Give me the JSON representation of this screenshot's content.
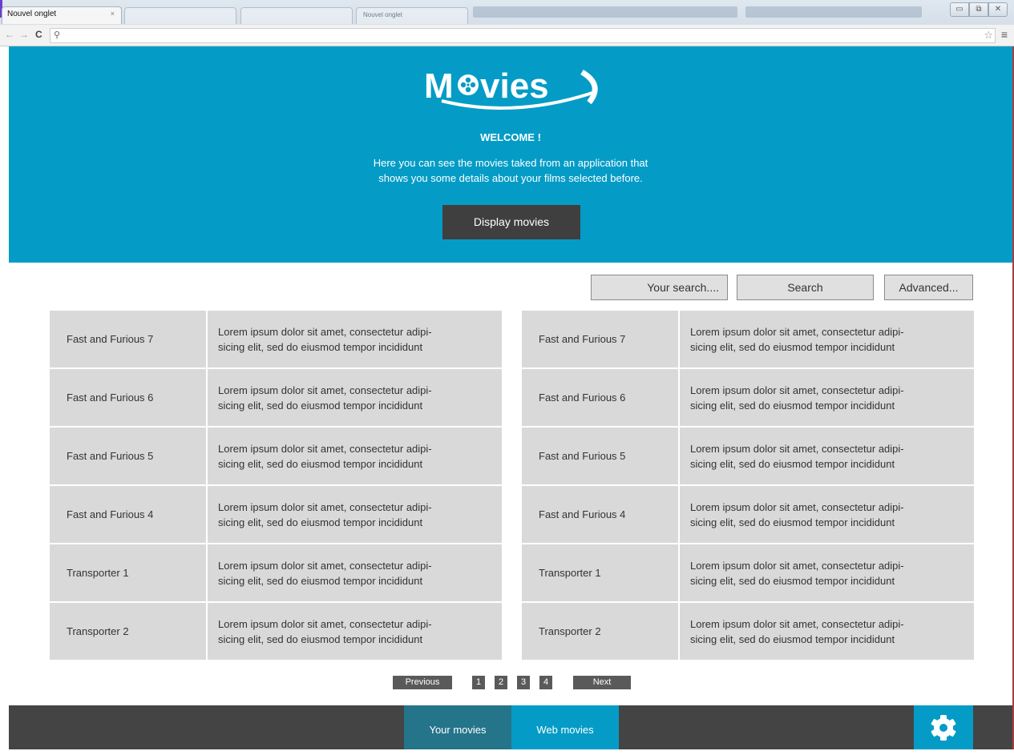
{
  "browser": {
    "active_tab_label": "Nouvel onglet",
    "tab_close": "×",
    "ghost_tab_3": "Nouvel onglet",
    "win_minimize": "▭",
    "win_restore": "⧉",
    "win_close": "✕",
    "back": "←",
    "forward": "→",
    "reload": "C",
    "search_glyph": "⚲",
    "star": "☆",
    "menu": "≡"
  },
  "hero": {
    "logo_text": "Movies",
    "welcome": "WELCOME !",
    "intro_line1": "Here you can see the movies taked from an application that",
    "intro_line2": "shows you some details about your films selected before.",
    "display_button": "Display movies"
  },
  "toolbar": {
    "search_placeholder": "Your search....",
    "search_button": "Search",
    "advanced_button": "Advanced..."
  },
  "movies_left": [
    {
      "title": "Fast and Furious 7",
      "desc_line1": "Lorem ipsum dolor sit amet, consectetur adipi-",
      "desc_line2": "sicing elit, sed do eiusmod tempor incididunt"
    },
    {
      "title": "Fast and Furious 6",
      "desc_line1": "Lorem ipsum dolor sit amet, consectetur adipi-",
      "desc_line2": "sicing elit, sed do eiusmod tempor incididunt"
    },
    {
      "title": "Fast and Furious 5",
      "desc_line1": "Lorem ipsum dolor sit amet, consectetur adipi-",
      "desc_line2": "sicing elit, sed do eiusmod tempor incididunt"
    },
    {
      "title": "Fast and Furious 4",
      "desc_line1": "Lorem ipsum dolor sit amet, consectetur adipi-",
      "desc_line2": "sicing elit, sed do eiusmod tempor incididunt"
    },
    {
      "title": "Transporter 1",
      "desc_line1": "Lorem ipsum dolor sit amet, consectetur adipi-",
      "desc_line2": "sicing elit, sed do eiusmod tempor incididunt"
    },
    {
      "title": "Transporter 2",
      "desc_line1": "Lorem ipsum dolor sit amet, consectetur adipi-",
      "desc_line2": "sicing elit, sed do eiusmod tempor incididunt"
    }
  ],
  "movies_right": [
    {
      "title": "Fast and Furious 7",
      "desc_line1": "Lorem ipsum dolor sit amet, consectetur adipi-",
      "desc_line2": "sicing elit, sed do eiusmod tempor incididunt"
    },
    {
      "title": "Fast and Furious 6",
      "desc_line1": "Lorem ipsum dolor sit amet, consectetur adipi-",
      "desc_line2": "sicing elit, sed do eiusmod tempor incididunt"
    },
    {
      "title": "Fast and Furious 5",
      "desc_line1": "Lorem ipsum dolor sit amet, consectetur adipi-",
      "desc_line2": "sicing elit, sed do eiusmod tempor incididunt"
    },
    {
      "title": "Fast and Furious 4",
      "desc_line1": "Lorem ipsum dolor sit amet, consectetur adipi-",
      "desc_line2": "sicing elit, sed do eiusmod tempor incididunt"
    },
    {
      "title": "Transporter 1",
      "desc_line1": "Lorem ipsum dolor sit amet, consectetur adipi-",
      "desc_line2": "sicing elit, sed do eiusmod tempor incididunt"
    },
    {
      "title": "Transporter 2",
      "desc_line1": "Lorem ipsum dolor sit amet, consectetur adipi-",
      "desc_line2": "sicing elit, sed do eiusmod tempor incididunt"
    }
  ],
  "pagination": {
    "previous": "Previous",
    "pages": [
      "1",
      "2",
      "3",
      "4"
    ],
    "next": "Next"
  },
  "footer": {
    "tab_your_movies": "Your movies",
    "tab_web_movies": "Web movies",
    "settings_icon": "gear-icon"
  },
  "colors": {
    "brand_blue": "#049cc6",
    "dark_button": "#3f3f3f",
    "footer_bg": "#444444",
    "active_footer_tab": "#24748a",
    "cell_bg": "#d9d9d9"
  }
}
